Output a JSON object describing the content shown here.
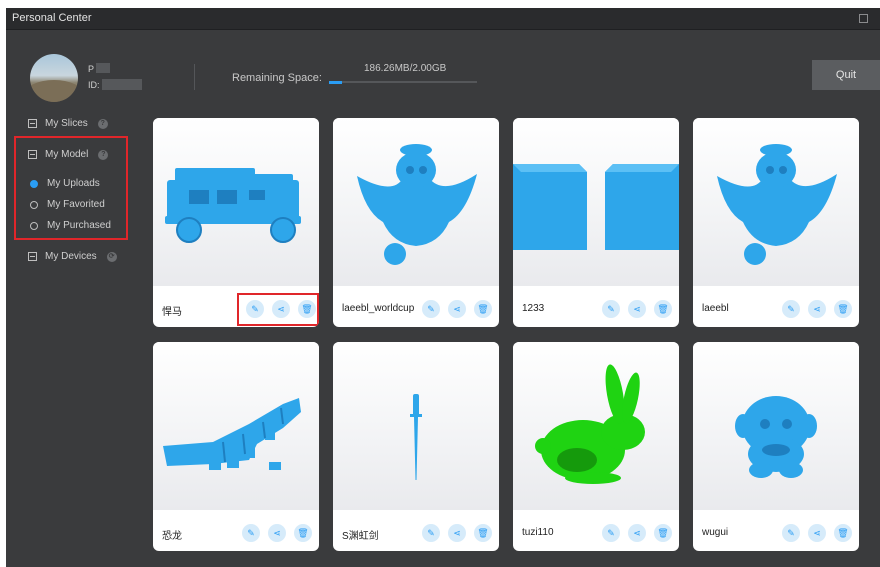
{
  "window": {
    "title": "Personal Center"
  },
  "user": {
    "name": "P",
    "id": "ID: 7"
  },
  "storage": {
    "label": "Remaining Space:",
    "value": "186.26MB/2.00GB",
    "used_fraction": 0.09
  },
  "quit_label": "Quit",
  "sidebar": {
    "slices": "My Slices",
    "model": "My Model",
    "uploads": "My Uploads",
    "favorited": "My Favorited",
    "purchased": "My Purchased",
    "devices": "My Devices",
    "help_glyph": "?",
    "devices_glyph": "⟳"
  },
  "models": [
    {
      "name": "悍马",
      "color": "#2ea6ea"
    },
    {
      "name": "laeebl_worldcup",
      "color": "#2ea6ea"
    },
    {
      "name": "1233",
      "color": "#2ea6ea"
    },
    {
      "name": "laeebl",
      "color": "#2ea6ea"
    },
    {
      "name": "恐龙",
      "color": "#2ea6ea"
    },
    {
      "name": "S渊虹剑",
      "color": "#2ea6ea"
    },
    {
      "name": "tuzi110",
      "color": "#1fd312"
    },
    {
      "name": "wugui",
      "color": "#2ea6ea"
    }
  ],
  "action_glyphs": {
    "edit": "✎",
    "share": "⋖",
    "delete": "🗑"
  },
  "accent": "#2a9df4",
  "highlight": "#e0262a"
}
